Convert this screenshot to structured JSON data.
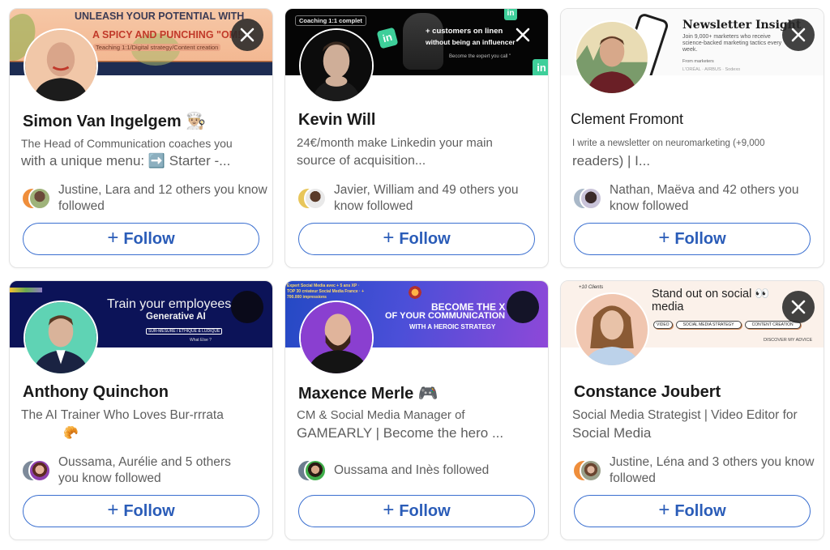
{
  "colors": {
    "follow_blue": "#2a5cb8",
    "follow_border": "#3a6fd0",
    "name_text": "#1a1a1a",
    "muted_text": "#5e5e5e",
    "dismiss_bg": "#282828"
  },
  "cards": [
    {
      "name": "Simon Van Ingelgem 👨🏼‍🍳",
      "headline_line1": "The Head of Communication coaches you",
      "headline_line2": "with a unique menu:    ➡️ Starter -...",
      "mutual": "Justine, Lara and 12 others you know followed",
      "follow_label": "Follow",
      "banner": {
        "title": "UNLEASH YOUR POTENTIAL WITH",
        "subtitle": "A SPICY AND PUNCHING \"OM!",
        "small": "Teaching 1:1/Digital strategy/Content creation"
      },
      "dismiss_icon": "close-icon"
    },
    {
      "name": "Kevin Will",
      "headline_line1": "24€/month make Linkedin your main",
      "headline_line2": "source of acquisition...",
      "mutual": "Javier, William and 49 others you know followed",
      "follow_label": "Follow",
      "banner": {
        "tag": "Coaching 1:1 complet",
        "title": "+ customers on linen",
        "subtitle": "without being an influencer",
        "small": "Become the expert you call \""
      },
      "dismiss_icon": "close-icon"
    },
    {
      "name": "Clement Fromont",
      "headline_line1": "I write a newsletter on neuromarketing (+9,000",
      "headline_line2": "readers) | I...",
      "mutual": "Nathan, Maëva and 42 others you know followed",
      "follow_label": "Follow",
      "banner": {
        "title": "Newsletter Insight",
        "subtitle": "Join 9,000+ marketers who receive science-backed marketing tactics every week.",
        "small": "From marketers",
        "logos": "L'ORÉAL   ·   AIRBUS   ·   Sodexo"
      },
      "dismiss_icon": "close-icon"
    },
    {
      "name": "Anthony Quinchon",
      "headline_line1": "The AI Trainer Who Loves Bur-rrrata",
      "headline_line2": "🥐",
      "mutual": "Oussama, Aurélie and 5 others you know followed",
      "follow_label": "Follow",
      "banner": {
        "title": "Train your employees in",
        "subtitle": "Generative AI",
        "small": "SUR-MESURE / ÉTHIQUE & LUDIQUE",
        "small2": "What Else ?"
      },
      "dismiss_icon": "close-icon"
    },
    {
      "name": "Maxence Merle 🎮",
      "headline_line1": "CM & Social Media Manager of",
      "headline_line2": "GAMEARLY | Become the hero      ...",
      "mutual": "Oussama and Inès followed",
      "follow_label": "Follow",
      "banner": {
        "small": "Expert Social Media avec + 5 ans XP · TOP 30 créateur Social Media France · + 700.000 impressions",
        "title": "BECOME THE X HERO",
        "subtitle": "OF YOUR COMMUNICATION",
        "small2": "WITH A HEROIC STRATEGY"
      },
      "dismiss_icon": "close-icon"
    },
    {
      "name": "Constance Joubert",
      "headline_line1": "Social Media Strategist | Video Editor for",
      "headline_line2": "Social Media",
      "mutual": "Justine, Léna and 3 others you know followed",
      "follow_label": "Follow",
      "banner": {
        "title": "Stand out on social 👀",
        "subtitle": "media",
        "chips": [
          "VIDEO",
          "SOCIAL MEDIA STRATEGY",
          "CONTENT CREATION"
        ],
        "small": "DISCOVER MY ADVICE",
        "tag": "+10 Clients"
      },
      "dismiss_icon": "close-icon"
    }
  ]
}
